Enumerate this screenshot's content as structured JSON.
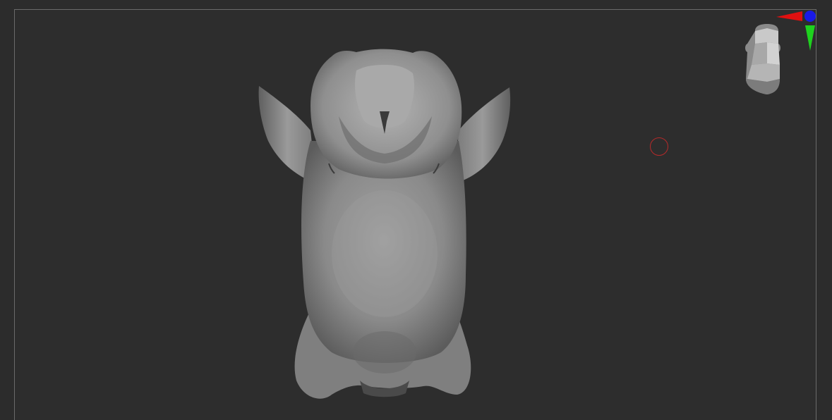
{
  "viewport": {
    "background": "#2d2d2d",
    "frame_color": "#6a6a6a"
  },
  "model": {
    "mesh_color": "#8c8c8c"
  },
  "nav_gizmo": {
    "icon": "head-orientation-icon",
    "axis_colors": {
      "x": "#e01010",
      "y": "#1ed21e",
      "z": "#1a1ae6"
    }
  },
  "brush_cursor": {
    "icon": "brush-cursor-icon",
    "color": "#b52a2a"
  }
}
